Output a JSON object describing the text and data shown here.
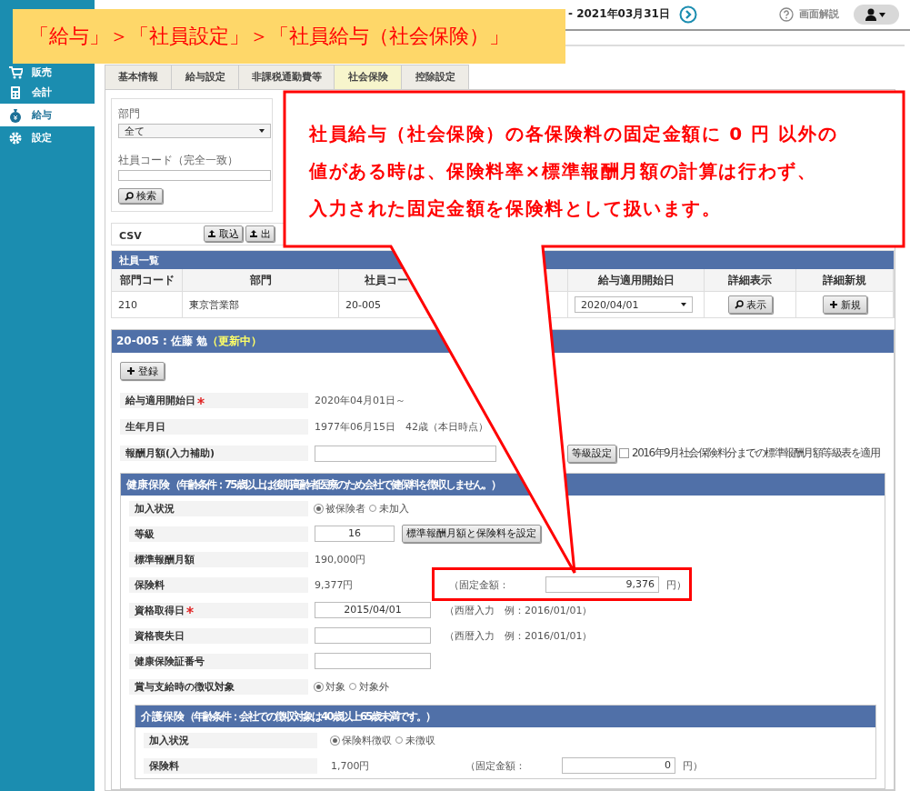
{
  "banner": {
    "text": "「給与」＞「社員設定」＞「社員給与（社会保険）」"
  },
  "callout": {
    "lines": [
      "社員給与（社会保険）の各保険料の固定金額に 0 円 以外の",
      "値がある時は、保険料率×標準報酬月額の計算は行わず、",
      "入力された固定金額を保険料として扱います。"
    ]
  },
  "sidebar": {
    "items": [
      {
        "label": "販売",
        "selected": false
      },
      {
        "label": "会計",
        "selected": false
      },
      {
        "label": "給与",
        "selected": true
      },
      {
        "label": "設定",
        "selected": false
      }
    ]
  },
  "header": {
    "date_range": "- 2021年03月31日",
    "help": "画面解説"
  },
  "tabs": [
    {
      "label": "基本情報",
      "selected": false
    },
    {
      "label": "給与設定",
      "selected": false
    },
    {
      "label": "非課税通勤費等",
      "selected": false
    },
    {
      "label": "社会保険",
      "selected": true
    },
    {
      "label": "控除設定",
      "selected": false
    }
  ],
  "search": {
    "department_label": "部門",
    "department_value": "全て",
    "code_label": "社員コード（完全一致）",
    "button": "検索"
  },
  "csv": {
    "label": "CSV",
    "buttons": [
      "取込",
      "出"
    ]
  },
  "employee_list": {
    "title": "社員一覧",
    "columns": [
      "部門コード",
      "部門",
      "社員コー",
      "給与適用開始日",
      "詳細表示",
      "詳細新規"
    ],
    "rows": [
      {
        "cells": [
          "210",
          "東京営業部",
          "20-005"
        ],
        "start_date": "2020/04/01",
        "view_button": "表示",
        "new_button": "新規"
      }
    ]
  },
  "detail": {
    "title": "20-005 : 佐藤 勉",
    "status": "（更新中）",
    "register_button": "登録",
    "rows": [
      {
        "label": "給与適用開始日",
        "required": true,
        "parts": [
          {
            "kind": "text",
            "text": "2020年04月01日～"
          }
        ]
      },
      {
        "label": "生年月日",
        "required": false,
        "parts": [
          {
            "kind": "text",
            "text": "1977年06月15日　42歳（本日時点）"
          }
        ]
      },
      {
        "label": "報酬月額(入力補助)",
        "required": false,
        "parts": [
          {
            "kind": "input_wide"
          },
          {
            "kind": "button",
            "label": "等級設定"
          },
          {
            "kind": "checkbox",
            "checked": false,
            "label": "2016年9月社会保険料分までの標準報酬月額等級表を適用"
          }
        ]
      }
    ],
    "health": {
      "title": "健康保険",
      "note": "（年齢条件：75歳以上は後期高齢者医療のため会社で健保料を徴収しません。）",
      "rows": [
        {
          "label": "加入状況",
          "required": false,
          "parts": [
            {
              "kind": "radio",
              "options": [
                {
                  "label": "被保険者",
                  "selected": true
                },
                {
                  "label": "未加入",
                  "selected": false
                }
              ]
            }
          ]
        },
        {
          "label": "等級",
          "required": false,
          "parts": [
            {
              "kind": "input_short",
              "value": "16"
            },
            {
              "kind": "button",
              "label": "標準報酬月額と保険料を設定"
            }
          ]
        },
        {
          "label": "標準報酬月額",
          "required": false,
          "parts": [
            {
              "kind": "text",
              "text": "190,000円"
            }
          ]
        },
        {
          "label": "保険料",
          "required": false,
          "parts": [
            {
              "kind": "text",
              "text": "9,377円"
            },
            {
              "kind": "fixed",
              "label": "（固定金額：",
              "value": "9,376",
              "unit": "円）"
            }
          ]
        },
        {
          "label": "資格取得日",
          "required": true,
          "parts": [
            {
              "kind": "input",
              "value": "2015/04/01"
            },
            {
              "kind": "note",
              "text": "（西暦入力　例：2016/01/01）"
            }
          ]
        },
        {
          "label": "資格喪失日",
          "required": false,
          "parts": [
            {
              "kind": "input"
            },
            {
              "kind": "note",
              "text": "（西暦入力　例：2016/01/01）"
            }
          ]
        },
        {
          "label": "健康保険証番号",
          "required": false,
          "parts": [
            {
              "kind": "input"
            }
          ]
        },
        {
          "label": "賞与支給時の徴収対象",
          "required": false,
          "parts": [
            {
              "kind": "radio",
              "options": [
                {
                  "label": "対象",
                  "selected": true
                },
                {
                  "label": "対象外",
                  "selected": false
                }
              ]
            }
          ]
        }
      ],
      "nursing": {
        "title": "介護保険",
        "note": "（年齢条件：会社での徴収対象は40歳以上65歳未満です。）",
        "rows": [
          {
            "label": "加入状況",
            "required": false,
            "parts": [
              {
                "kind": "radio",
                "options": [
                  {
                    "label": "保険料徴収",
                    "selected": true
                  },
                  {
                    "label": "未徴収",
                    "selected": false
                  }
                ]
              }
            ]
          },
          {
            "label": "保険料",
            "required": false,
            "parts": [
              {
                "kind": "text",
                "text": "1,700円"
              },
              {
                "kind": "fixed",
                "label": "（固定金額：",
                "value": "0",
                "unit": "円）"
              }
            ]
          }
        ]
      }
    }
  }
}
